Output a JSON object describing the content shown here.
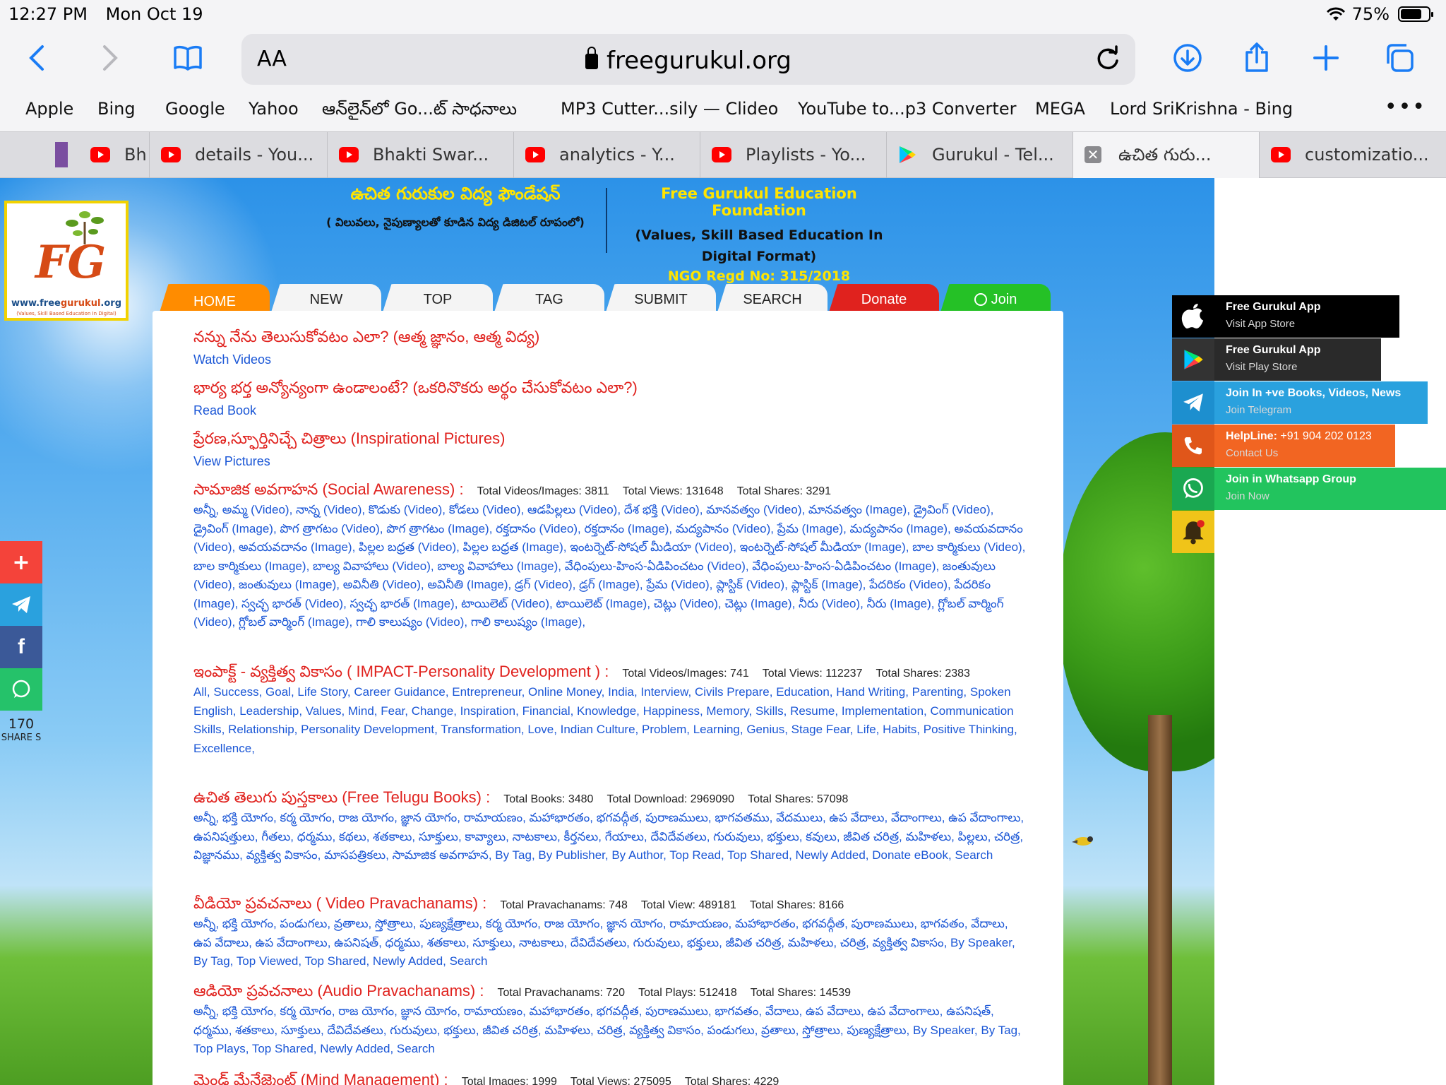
{
  "status_bar": {
    "time": "12:27 PM",
    "date": "Mon Oct 19",
    "battery": "75%"
  },
  "toolbar": {
    "reader_label": "AA",
    "url": "freegurukul.org"
  },
  "bookmarks": [
    "Apple",
    "Bing",
    "Google",
    "Yahoo",
    "ఆన్‌లైన్‌లో Go...ట్ సాధనాలు",
    "MP3 Cutter...sily — Clideo",
    "YouTube to...p3 Converter",
    "MEGA",
    "Lord SriKrishna - Bing"
  ],
  "tabs": [
    {
      "label": "Bh"
    },
    {
      "label": "details - You..."
    },
    {
      "label": "Bhakti Swar..."
    },
    {
      "label": "analytics - Y..."
    },
    {
      "label": "Playlists - Yo..."
    },
    {
      "label": "Gurukul - Tel..."
    },
    {
      "label": "ఉచిత గురు..."
    },
    {
      "label": "customizatio..."
    }
  ],
  "logo": {
    "text": "FG",
    "url_prefix": "www.free",
    "url_brand": "gurukul",
    "url_suffix": ".org",
    "tagline": "(Values, Skill Based Education In Digital)"
  },
  "header": {
    "te_title": "ఉచిత గురుకుల విద్య ఫౌండేషన్",
    "te_sub": "( విలువలు, నైపుణ్యాలతో కూడిన విద్య డిజిటల్ రూపంలో)",
    "en_title": "Free Gurukul Education Foundation",
    "en_sub": "(Values, Skill Based Education In Digital Format)",
    "ngo": "NGO Regd No: 315/2018"
  },
  "nav": [
    "HOME",
    "NEW",
    "TOP",
    "TAG",
    "SUBMIT",
    "SEARCH",
    "Donate",
    "Join"
  ],
  "featured": [
    {
      "title": "నన్ను నేను తెలుసుకోవటం ఎలా? (ఆత్మ జ్ఞానం, ఆత్మ విద్య)",
      "link": "Watch Videos"
    },
    {
      "title": "భార్య భర్త అన్యోన్యంగా ఉండాలంటే? (ఒకరినొకరు అర్థం చేసుకోవటం ఎలా?)",
      "link": "Read Book"
    },
    {
      "title": "ప్రేరణ,స్ఫూర్తినిచ్చే చిత్రాలు (Inspirational Pictures)",
      "link": "View Pictures"
    }
  ],
  "categories": [
    {
      "title": "సామాజిక అవగాహన (Social Awareness) :",
      "stats": [
        "Total Videos/Images: 3811",
        "Total Views: 131648",
        "Total Shares: 3291"
      ],
      "links": "అన్నీ, అమ్మ (Video), నాన్న (Video), కొడుకు (Video), కోడలు (Video), ఆడపిల్లలు (Video), దేశ భక్తి (Video), మానవత్వం (Video), మానవత్వం (Image), డ్రైవింగ్ (Video), డ్రైవింగ్ (Image), పొగ త్రాగటం (Video), పొగ త్రాగటం (Image), రక్తదానం (Video), రక్తదానం (Image), మద్యపానం (Video), ప్రేమ (Image), మద్యపానం (Image), అవయవదానం (Video), అవయవదానం (Image), పిల్లల బధ్రత (Video), పిల్లల బధ్రత (Image), ఇంటర్నెట్-సోషల్ మీడియా (Video), ఇంటర్నెట్-సోషల్ మీడియా (Image), బాల కార్మికులు (Video), బాల కార్మికులు (Image), బాల్య వివాహాలు (Video), బాల్య వివాహాలు (Image), వేధింపులు-హింస-ఏడిపించటం (Video), వేధింపులు-హింస-ఏడిపించటం (Image), జంతువులు (Video), జంతువులు (Image), అవినీతి (Video), అవినీతి (Image), డ్రగ్ (Video), డ్రగ్ (Image), ప్రేమ (Video), ప్లాస్టిక్ (Video), ప్లాస్టిక్ (Image), పేదరికం (Video), పేదరికం (Image), స్వచ్ఛ భారత్ (Video), స్వచ్ఛ భారత్ (Image), టాయిలెట్ (Video), టాయిలెట్ (Image), చెట్లు (Video), చెట్లు (Image), నీరు (Video), నీరు (Image), గ్లోబల్ వార్మింగ్ (Video), గ్లోబల్ వార్మింగ్ (Image), గాలి కాలుష్యం (Video), గాలి కాలుష్యం (Image),"
    },
    {
      "title": "ఇంపాక్ట్ - వ్యక్తిత్వ వికాసం ( IMPACT-Personality Development ) :",
      "stats": [
        "Total Videos/Images: 741",
        "Total Views: 112237",
        "Total Shares: 2383"
      ],
      "links": "All, Success, Goal, Life Story, Career Guidance, Entrepreneur, Online Money, India, Interview, Civils Prepare, Education, Hand Writing, Parenting, Spoken English, Leadership, Values, Mind, Fear, Change, Inspiration, Financial, Knowledge, Happiness, Memory, Skills, Resume, Implementation, Communication Skills, Relationship, Personality Development, Transformation, Love, Indian Culture, Problem, Learning, Genius, Stage Fear, Life, Habits, Positive Thinking, Excellence,"
    },
    {
      "title": "ఉచిత తెలుగు పుస్తకాలు (Free Telugu Books) :",
      "stats": [
        "Total Books: 3480",
        "Total Download: 2969090",
        "Total Shares: 57098"
      ],
      "links": "అన్నీ, భక్తి యోగం, కర్మ యోగం, రాజ యోగం, జ్ఞాన యోగం, రామాయణం, మహాభారతం, భగవద్గీత, పురాణములు, భాగవతము, వేదములు, ఉప వేదాలు, వేదాంగాలు, ఉప వేదాంగాలు, ఉపనిషత్తులు, గీతలు, ధర్మము, కథలు, శతకాలు, సూక్తులు, కావ్యాలు, నాటకాలు, కీర్తనలు, గేయాలు, దేవిదేవతలు, గురువులు, భక్తులు, కవులు, జీవిత చరిత్ర, మహిళలు, పిల్లలు, చరిత్ర, విజ్ఞానము, వ్యక్తిత్వ వికాసం, మాసపత్రికలు, సామాజిక అవగాహన, By Tag, By Publisher, By Author, Top Read, Top Shared, Newly Added, Donate eBook, Search"
    },
    {
      "title": "వీడియో ప్రవచనాలు ( Video Pravachanams) :",
      "stats": [
        "Total Pravachanams: 748",
        "Total View: 489181",
        "Total Shares: 8166"
      ],
      "links": "అన్నీ, భక్తి యోగం, పండుగలు, వ్రతాలు, స్తోత్రాలు, పుణ్యక్షేత్రాలు, కర్మ యోగం, రాజ యోగం, జ్ఞాన యోగం, రామాయణం, మహాభారతం, భగవద్గీత, పురాణములు, భాగవతం, వేదాలు, ఉప వేదాలు, ఉప వేదాంగాలు, ఉపనిషత్, ధర్మము, శతకాలు, సూక్తులు, నాటకాలు, దేవిదేవతలు, గురువులు, భక్తులు, జీవిత చరిత్ర, మహిళలు, చరిత్ర, వ్యక్తిత్వ వికాసం, By Speaker, By Tag, Top Viewed, Top Shared, Newly Added, Search"
    },
    {
      "title": "ఆడియో ప్రవచనాలు (Audio Pravachanams) :",
      "stats": [
        "Total Pravachanams: 720",
        "Total Plays: 512418",
        "Total Shares: 14539"
      ],
      "links": "అన్నీ, భక్తి యోగం, కర్మ యోగం, రాజ యోగం, జ్ఞాన యోగం, రామాయణం, మహాభారతం, భగవద్గీత, పురాణములు, భాగవతం, వేదాలు, ఉప వేదాలు, ఉప వేదాంగాలు, ఉపనిషత్, ధర్మము, శతకాలు, సూక్తులు, దేవిదేవతలు, గురువులు, భక్తులు, జీవిత చరిత్ర, మహిళలు, చరిత్ర, వ్యక్తిత్వ వికాసం, పండుగలు, వ్రతాలు, స్తోత్రాలు, పుణ్యక్షేత్రాలు, By Speaker, By Tag, Top Plays, Top Shared, Newly Added, Search"
    },
    {
      "title": "మైండ్ మేనేజ్మెంట్ (Mind Management) :",
      "stats": [
        "Total Images: 1999",
        "Total Views: 275095",
        "Total Shares: 4229"
      ],
      "links": ""
    }
  ],
  "share_bar": {
    "count": "170",
    "label": "SHARE S"
  },
  "widgets": [
    {
      "title": "Free Gurukul App",
      "sub": "Visit App Store",
      "color": "#000000",
      "icon": "apple-icon"
    },
    {
      "title": "Free Gurukul App",
      "sub": "Visit Play Store",
      "color": "#222222",
      "icon": "play-store-icon"
    },
    {
      "title": "Join In +ve Books, Videos, News",
      "sub": "Join Telegram",
      "color": "#2aa1de",
      "icon": "telegram-icon"
    },
    {
      "title": "HelpLine:",
      "title_value": "+91 904 202 0123",
      "sub": "Contact Us",
      "color": "#f26522",
      "icon": "phone-icon"
    },
    {
      "title": "Join in Whatsapp Group",
      "sub": "Join Now",
      "color": "#22c45e",
      "icon": "whatsapp-icon"
    }
  ],
  "colors": {
    "safari_blue": "#1a7cf5",
    "title_red": "#e0221e",
    "link_blue": "#1a56d6",
    "nav_home": "#ff8c00",
    "nav_donate": "#e0221e",
    "nav_join": "#25c126"
  }
}
